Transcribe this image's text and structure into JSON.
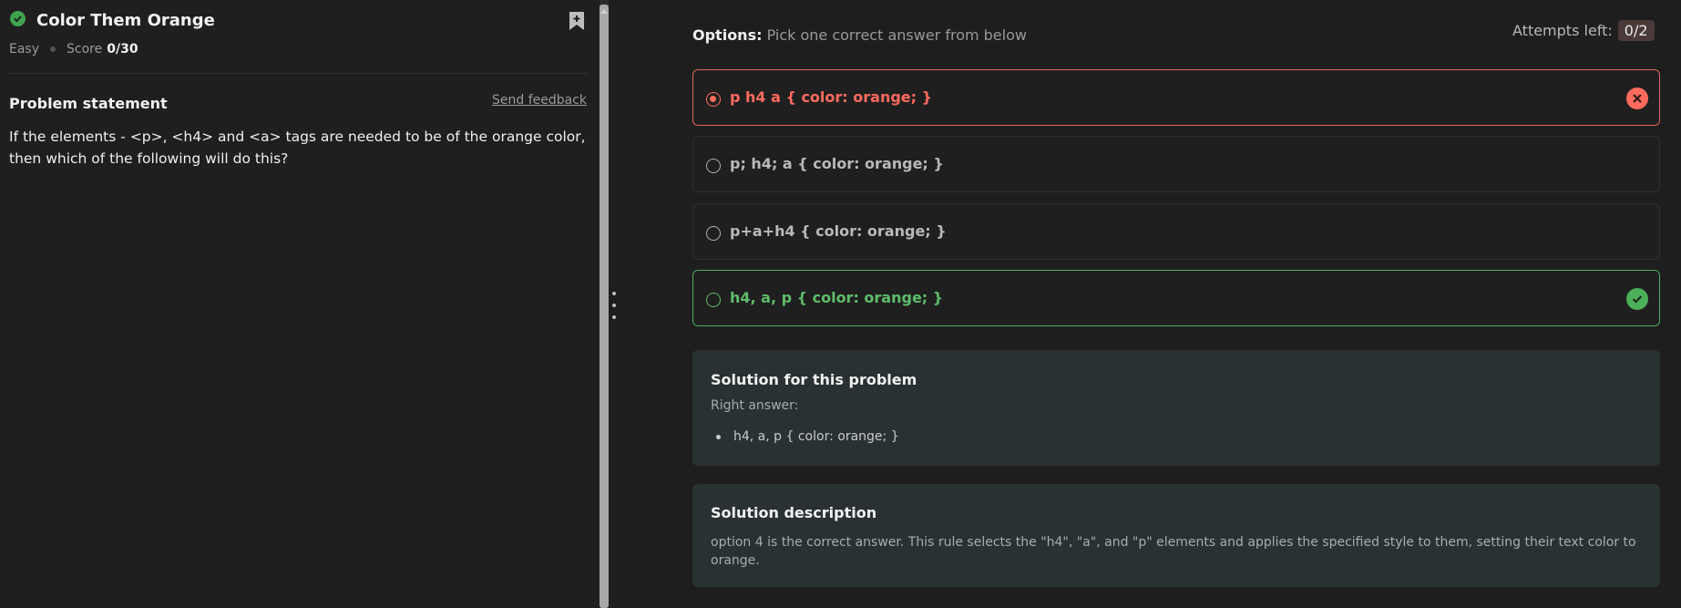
{
  "problem": {
    "title": "Color Them Orange",
    "difficulty": "Easy",
    "score_label": "Score",
    "score_value": "0/30",
    "statement_heading": "Problem statement",
    "feedback_link": "Send feedback",
    "statement_text": "If the elements - <p>, <h4> and <a> tags are needed to be of the orange color, then which of the following will do this?"
  },
  "options_panel": {
    "heading_bold": "Options:",
    "heading_sub": "Pick one correct answer from below",
    "attempts_label": "Attempts left:",
    "attempts_value": "0/2",
    "options": [
      {
        "label": "p h4 a { color: orange; }",
        "state": "wrong-selected"
      },
      {
        "label": "p; h4; a { color: orange; }",
        "state": "none"
      },
      {
        "label": "p+a+h4 { color: orange; }",
        "state": "none"
      },
      {
        "label": "h4, a, p { color: orange; }",
        "state": "correct"
      }
    ]
  },
  "solution": {
    "title": "Solution for this problem",
    "right_answer_label": "Right answer:",
    "right_answers": [
      "h4, a, p { color: orange; }"
    ]
  },
  "solution_description": {
    "title": "Solution description",
    "text": "option 4 is the correct answer. This rule selects the \"h4\", \"a\", and \"p\" elements and applies the specified style to them, setting their text color to orange."
  },
  "icons": {
    "status": "check-circle-icon",
    "bookmark": "bookmark-plus-icon",
    "wrong": "x-circle-icon",
    "correct": "check-circle-icon"
  },
  "colors": {
    "wrong": "#ff6b5e",
    "correct": "#4caf5a",
    "card_bg": "#2a3133"
  }
}
